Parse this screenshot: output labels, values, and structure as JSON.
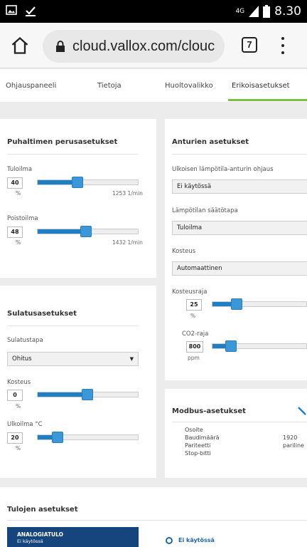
{
  "status_bar": {
    "signal": "4G",
    "time": "8.30",
    "icons": [
      "image-icon",
      "download-done-icon",
      "signal-icon",
      "battery-icon"
    ]
  },
  "browser": {
    "url": "cloud.vallox.com/clouc",
    "tab_count": "7"
  },
  "tabs": [
    {
      "label": "Ohjauspaneeli"
    },
    {
      "label": "Tietoja"
    },
    {
      "label": "Huoltovalikko"
    },
    {
      "label": "Erikoisasetukset"
    }
  ],
  "colors": {
    "accent": "#1f7fc4",
    "tab_active": "#7dc142",
    "dark_blue": "#16457d"
  },
  "fan": {
    "title": "Puhaltimen perusasetukset",
    "supply": {
      "label": "Tuloilma",
      "value": "40",
      "unit": "%",
      "flow": "1253 1/min",
      "level": 0.4
    },
    "exhaust": {
      "label": "Poistoilma",
      "value": "48",
      "unit": "%",
      "flow": "1432 1/min",
      "level": 0.48
    }
  },
  "defrost": {
    "title": "Sulatusasetukset",
    "method_label": "Sulatustapa",
    "method_value": "Ohitus",
    "humidity": {
      "label": "Kosteus",
      "value": "0",
      "unit": "%"
    },
    "outdoor": {
      "label": "Ulkoilma °C",
      "value": "20",
      "unit": "%"
    }
  },
  "sensor": {
    "title": "Anturien asetukset",
    "outdoor_label": "Ulkoisen lämpötila-anturin ohjaus",
    "outdoor_value": "Ei käytössä",
    "temp_ctrl_label": "Lämpötilan säätötapa",
    "temp_ctrl_value": "Tuloilma",
    "humidity_label": "Kosteus",
    "humidity_value": "Automaattinen",
    "hum_limit": {
      "label": "Kosteusraja",
      "value": "25",
      "unit": "%"
    },
    "co2_limit": {
      "label": "CO2-raja",
      "value": "800",
      "unit": "ppm"
    }
  },
  "modbus": {
    "title": "Modbus-asetukset",
    "rows": [
      {
        "label": "Osoite",
        "value": ""
      },
      {
        "label": "Baudimäärä",
        "value": "1920"
      },
      {
        "label": "Pariteetti",
        "value": "pariline"
      },
      {
        "label": "Stop-bitti",
        "value": ""
      }
    ]
  },
  "inputs": {
    "title": "Tulojen asetukset",
    "analog_title": "ANALOGIATULO",
    "analog_sub": "Ei käytössä",
    "radio_label": "Ei käytössä"
  }
}
